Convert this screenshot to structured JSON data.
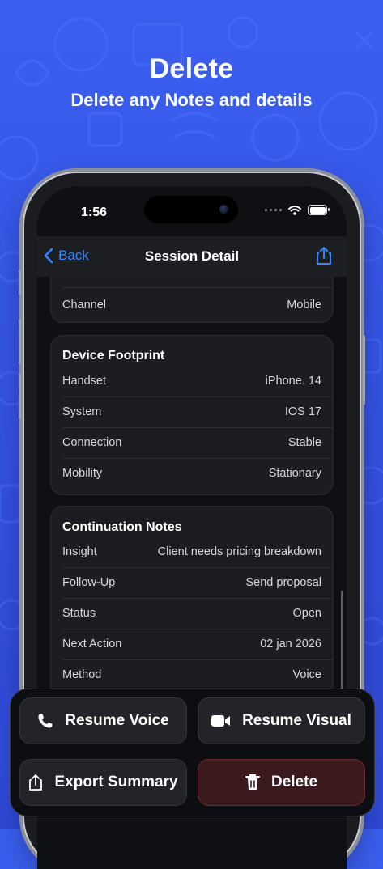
{
  "hero": {
    "title": "Delete",
    "subtitle": "Delete any Notes and details"
  },
  "status_bar": {
    "time": "1:56",
    "icons": [
      "signal-dots-icon",
      "wifi-icon",
      "battery-icon"
    ]
  },
  "nav": {
    "back_label": "Back",
    "title": "Session Detail",
    "share_icon": "share-icon"
  },
  "session_card": {
    "partial_top_label": "",
    "rows": [
      {
        "key": "Channel",
        "value": "Mobile"
      }
    ]
  },
  "device_card": {
    "title": "Device Footprint",
    "rows": [
      {
        "key": "Handset",
        "value": "iPhone. 14"
      },
      {
        "key": "System",
        "value": "IOS 17"
      },
      {
        "key": "Connection",
        "value": "Stable"
      },
      {
        "key": "Mobility",
        "value": "Stationary"
      }
    ]
  },
  "notes_card": {
    "title": "Continuation Notes",
    "rows": [
      {
        "key": "Insight",
        "value": "Client needs pricing breakdown"
      },
      {
        "key": "Follow-Up",
        "value": "Send proposal"
      },
      {
        "key": "Status",
        "value": "Open"
      },
      {
        "key": "Next Action",
        "value": "02 jan 2026"
      },
      {
        "key": "Method",
        "value": "Voice"
      }
    ]
  },
  "actions": {
    "resume_voice": "Resume Voice",
    "resume_visual": "Resume Visual",
    "export_summary": "Export Summary",
    "delete": "Delete"
  },
  "colors": {
    "background": "#3554e6",
    "accent": "#2f88ff",
    "card": "#1c1d22",
    "danger_bg": "#3b1a1e",
    "danger_border": "#6b2a30"
  }
}
